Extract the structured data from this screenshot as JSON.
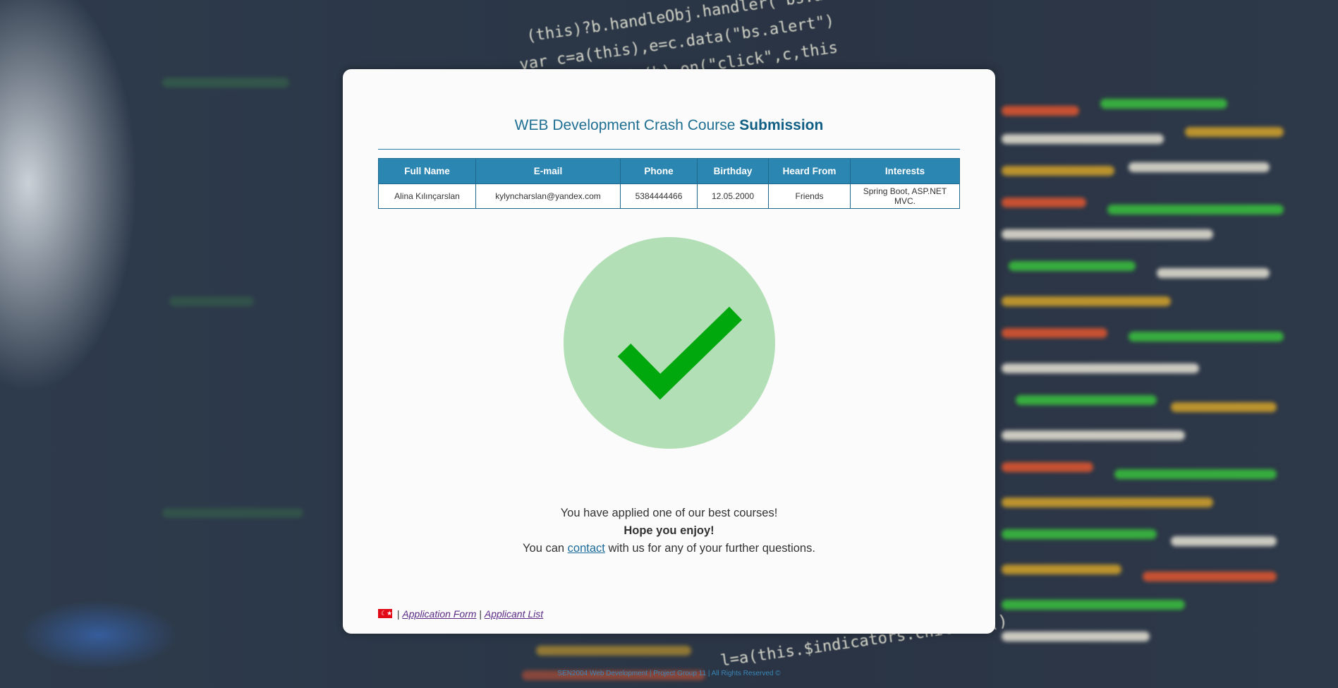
{
  "header": {
    "title_normal": "WEB Development Crash Course ",
    "title_bold": "Submission"
  },
  "table": {
    "columns": [
      "Full Name",
      "E-mail",
      "Phone",
      "Birthday",
      "Heard From",
      "Interests"
    ],
    "rows": [
      [
        "Alina Kılınçarslan",
        "kylyncharslan@yandex.com",
        "5384444466",
        "12.05.2000",
        "Friends",
        "Spring Boot, ASP.NET MVC."
      ]
    ]
  },
  "status": {
    "icon": "checkmark-icon",
    "circle_color": "#b3dfb7",
    "check_color": "#00a80d"
  },
  "message": {
    "line1": "You have applied one of our best courses!",
    "line2": "Hope you enjoy!",
    "line3_prefix": "You can ",
    "line3_link": "contact",
    "line3_suffix": " with us for any of your further questions."
  },
  "nav": {
    "flag_icon": "turkish-flag-icon",
    "separator": "|",
    "application_form": "Application Form",
    "applicant_list": "Applicant List"
  },
  "site_footer": {
    "text": "SEN2004 Web Development | Project Group 11 | All Rights Reserved ©"
  },
  "colors": {
    "accent": "#2b86b1",
    "title": "#1f6f93",
    "link_visited": "#5b2a86"
  }
}
